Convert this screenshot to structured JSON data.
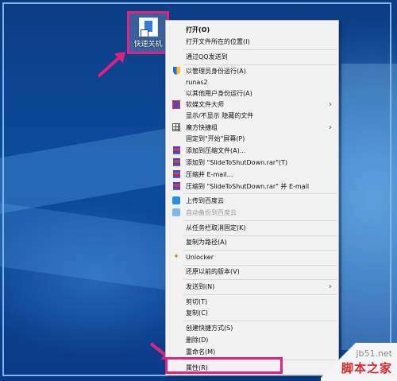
{
  "desktop": {
    "icon_label": "快速关机"
  },
  "menu": {
    "items": [
      {
        "label": "打开(O)",
        "bold": true,
        "icon": ""
      },
      {
        "label": "打开文件所在的位置(I)",
        "icon": ""
      },
      {
        "label": "通过QQ发送到",
        "icon": ""
      },
      {
        "label": "以管理员身份运行(A)",
        "icon": "shield-icon"
      },
      {
        "label": "runas2",
        "icon": ""
      },
      {
        "label": "以其他用户身份运行(A)",
        "icon": ""
      },
      {
        "label": "软媒文件大师",
        "icon": "box-icon",
        "submenu": true
      },
      {
        "label": "显示/不显示 隐藏的文件",
        "icon": ""
      },
      {
        "label": "魔方快捷组",
        "icon": "grid-icon",
        "submenu": true
      },
      {
        "label": "固定到\"开始\"屏幕(P)",
        "icon": ""
      },
      {
        "label": "添加到压缩文件(A)...",
        "icon": "winrar-icon"
      },
      {
        "label": "添加到 \"SlideToShutDown.rar\"(T)",
        "icon": "winrar-icon"
      },
      {
        "label": "压缩并 E-mail...",
        "icon": "winrar-icon"
      },
      {
        "label": "压缩到 \"SlideToShutDown.rar\" 并 E-mail",
        "icon": "winrar-icon"
      },
      {
        "label": "上传到百度云",
        "icon": "baidu-cloud-icon"
      },
      {
        "label": "自动备份到百度云",
        "icon": "baidu-cloud-icon",
        "disabled": true
      },
      {
        "label": "从任务栏取消固定(K)",
        "icon": ""
      },
      {
        "label": "复制为路径(A)",
        "icon": ""
      },
      {
        "label": "Unlocker",
        "icon": "wand-icon"
      },
      {
        "label": "还原以前的版本(V)",
        "icon": ""
      },
      {
        "label": "发送到(N)",
        "icon": "",
        "submenu": true
      },
      {
        "label": "剪切(T)",
        "icon": ""
      },
      {
        "label": "复制(C)",
        "icon": ""
      },
      {
        "label": "创建快捷方式(S)",
        "icon": ""
      },
      {
        "label": "删除(D)",
        "icon": ""
      },
      {
        "label": "重命名(M)",
        "icon": ""
      },
      {
        "label": "属性(R)",
        "icon": ""
      }
    ],
    "submenu_glyph": "›"
  },
  "watermark": {
    "url": "jb51.net",
    "name": "脚本之家"
  },
  "colors": {
    "highlight": "#e0217f",
    "menu_bg": "#f2f2f2"
  }
}
